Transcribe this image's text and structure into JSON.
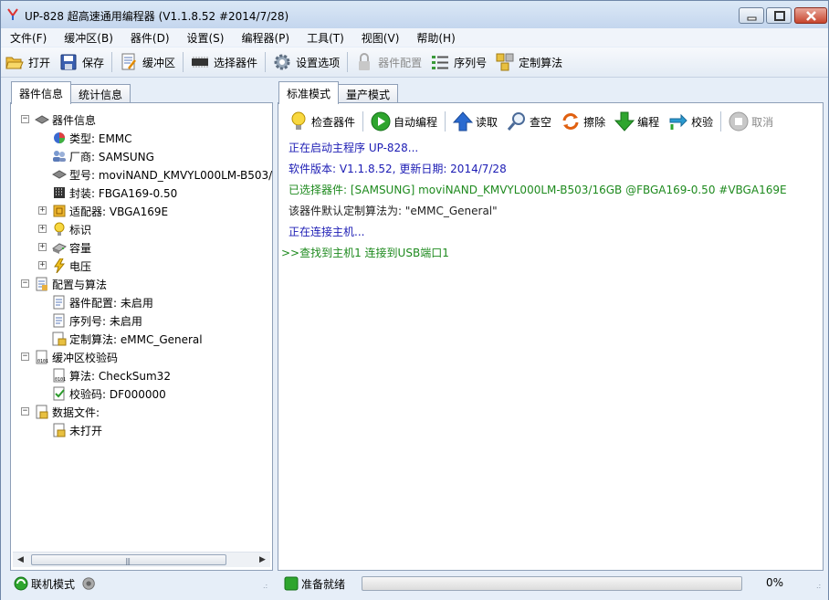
{
  "window": {
    "title": "UP-828 超高速通用编程器  (V1.1.8.52 #2014/7/28)"
  },
  "menu": [
    "文件(F)",
    "缓冲区(B)",
    "器件(D)",
    "设置(S)",
    "编程器(P)",
    "工具(T)",
    "视图(V)",
    "帮助(H)"
  ],
  "toolbar": {
    "open": "打开",
    "save": "保存",
    "buffer": "缓冲区",
    "select_device": "选择器件",
    "settings": "设置选项",
    "device_config": "器件配置",
    "serial": "序列号",
    "custom_algo": "定制算法"
  },
  "left_tabs": [
    "器件信息",
    "统计信息"
  ],
  "right_tabs": [
    "标准模式",
    "量产模式"
  ],
  "tree": {
    "device_info": "器件信息",
    "type": "类型: EMMC",
    "vendor": "厂商: SAMSUNG",
    "model": "型号: moviNAND_KMVYL000LM-B503/",
    "package": "封装: FBGA169-0.50",
    "adapter": "适配器: VBGA169E",
    "mark": "标识",
    "capacity": "容量",
    "voltage": "电压",
    "config_algo": "配置与算法",
    "device_config": "器件配置: 未启用",
    "serial": "序列号: 未启用",
    "custom_algo": "定制算法: eMMC_General",
    "buffer_checksum": "缓冲区校验码",
    "algorithm": "算法: CheckSum32",
    "checksum": "校验码: DF000000",
    "data_file": "数据文件:",
    "not_open": "未打开"
  },
  "actions": {
    "check": "检查器件",
    "auto": "自动编程",
    "read": "读取",
    "blank": "查空",
    "erase": "擦除",
    "program": "编程",
    "verify": "校验",
    "cancel": "取消"
  },
  "log": [
    {
      "text": "正在启动主程序 UP-828...",
      "color": "#1c1cb4"
    },
    {
      "text": "软件版本: V1.1.8.52, 更新日期: 2014/7/28",
      "color": "#1c1cb4"
    },
    {
      "text": "已选择器件: [SAMSUNG] moviNAND_KMVYL000LM-B503/16GB @FBGA169-0.50 #VBGA169E",
      "color": "#1e8a1e"
    },
    {
      "text": "该器件默认定制算法为: \"eMMC_General\"",
      "color": "#222222"
    },
    {
      "text": "正在连接主机...",
      "color": "#1c1cb4"
    },
    {
      "text": ">>查找到主机1 连接到USB端口1",
      "color": "#1e8a1e"
    }
  ],
  "status": {
    "mode": "联机模式",
    "ready": "准备就绪",
    "progress_percent": 0,
    "progress_text": "0%"
  },
  "colors": {
    "log_blue": "#1c1cb4",
    "log_green": "#1e8a1e",
    "progress_green": "#3cb043"
  }
}
